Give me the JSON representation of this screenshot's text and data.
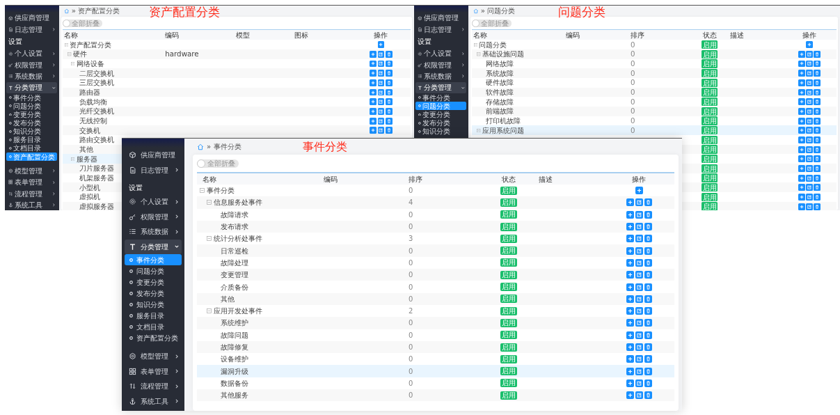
{
  "windows": [
    {
      "annotation": "资产配置分类",
      "breadcrumb": {
        "separator": "»",
        "current": "资产配置分类"
      },
      "toggle": {
        "label": "全部折叠",
        "on": false
      },
      "sidebar": [
        {
          "kind": "menu",
          "label": "供应商管理"
        },
        {
          "kind": "menu",
          "label": "日志管理",
          "expanded": false
        },
        {
          "kind": "section",
          "label": "设置"
        },
        {
          "kind": "menu",
          "label": "个人设置",
          "expanded": false
        },
        {
          "kind": "menu",
          "label": "权限管理",
          "expanded": false
        },
        {
          "kind": "menu",
          "label": "系统数据",
          "expanded": false
        },
        {
          "kind": "menu",
          "label": "分类管理",
          "expanded": true,
          "children": [
            {
              "label": "事件分类",
              "selected": false
            },
            {
              "label": "问题分类",
              "selected": false
            },
            {
              "label": "变更分类",
              "selected": false
            },
            {
              "label": "发布分类",
              "selected": false
            },
            {
              "label": "知识分类",
              "selected": false
            },
            {
              "label": "服务目录",
              "selected": false
            },
            {
              "label": "文档目录",
              "selected": false
            },
            {
              "label": "资产配置分类",
              "selected": true
            }
          ]
        },
        {
          "kind": "menu",
          "label": "模型管理",
          "expanded": false
        },
        {
          "kind": "menu",
          "label": "表单管理",
          "expanded": false
        },
        {
          "kind": "menu",
          "label": "流程管理",
          "expanded": false
        },
        {
          "kind": "menu",
          "label": "系统工具",
          "expanded": false
        }
      ],
      "table": {
        "columns": [
          {
            "label": "名称",
            "kind": "name"
          },
          {
            "label": "编码",
            "kind": "code"
          },
          {
            "label": "模型",
            "kind": "text"
          },
          {
            "label": "图标",
            "kind": "text"
          },
          {
            "label": "操作",
            "kind": "actions"
          }
        ],
        "rows": [
          {
            "name": "资产配置分类",
            "expanded": true,
            "highlighted": false,
            "actions": [
              {
                "kind": "add"
              }
            ],
            "children": [
              {
                "name": "硬件",
                "code": "hardware",
                "expanded": true,
                "highlighted": false,
                "actions": [
                  {
                    "kind": "add"
                  },
                  {
                    "kind": "edit"
                  },
                  {
                    "kind": "delete"
                  }
                ],
                "children": [
                  {
                    "name": "网络设备",
                    "expanded": true,
                    "highlighted": false,
                    "actions": [
                      {
                        "kind": "add"
                      },
                      {
                        "kind": "edit"
                      },
                      {
                        "kind": "delete"
                      }
                    ],
                    "children": [
                      {
                        "name": "二层交换机",
                        "highlighted": false,
                        "actions": [
                          {
                            "kind": "add"
                          },
                          {
                            "kind": "edit"
                          },
                          {
                            "kind": "delete"
                          }
                        ]
                      },
                      {
                        "name": "三层交换机",
                        "highlighted": false,
                        "actions": [
                          {
                            "kind": "add"
                          },
                          {
                            "kind": "edit"
                          },
                          {
                            "kind": "delete"
                          }
                        ]
                      },
                      {
                        "name": "路由器",
                        "highlighted": false,
                        "actions": [
                          {
                            "kind": "add"
                          },
                          {
                            "kind": "edit"
                          },
                          {
                            "kind": "delete"
                          }
                        ]
                      },
                      {
                        "name": "负载均衡",
                        "highlighted": false,
                        "actions": [
                          {
                            "kind": "add"
                          },
                          {
                            "kind": "edit"
                          },
                          {
                            "kind": "delete"
                          }
                        ]
                      },
                      {
                        "name": "光纤交换机",
                        "highlighted": false,
                        "actions": [
                          {
                            "kind": "add"
                          },
                          {
                            "kind": "edit"
                          },
                          {
                            "kind": "delete"
                          }
                        ]
                      },
                      {
                        "name": "无线控制",
                        "highlighted": false,
                        "actions": [
                          {
                            "kind": "add"
                          },
                          {
                            "kind": "edit"
                          },
                          {
                            "kind": "delete"
                          }
                        ]
                      },
                      {
                        "name": "交换机",
                        "highlighted": false,
                        "actions": [
                          {
                            "kind": "add"
                          },
                          {
                            "kind": "edit"
                          },
                          {
                            "kind": "delete"
                          }
                        ]
                      },
                      {
                        "name": "路由交换机",
                        "highlighted": false
                      },
                      {
                        "name": "其他",
                        "highlighted": false
                      }
                    ]
                  },
                  {
                    "name": "服务器",
                    "expanded": true,
                    "highlighted": true,
                    "children": [
                      {
                        "name": "刀片服务器",
                        "highlighted": false
                      },
                      {
                        "name": "机架服务器",
                        "highlighted": false
                      },
                      {
                        "name": "小型机",
                        "highlighted": false
                      },
                      {
                        "name": "虚拟机",
                        "highlighted": false
                      },
                      {
                        "name": "虚拟服务器",
                        "highlighted": false
                      }
                    ]
                  }
                ]
              }
            ]
          }
        ]
      }
    },
    {
      "annotation": "问题分类",
      "breadcrumb": {
        "separator": "»",
        "current": "问题分类"
      },
      "toggle": {
        "label": "全部折叠",
        "on": false
      },
      "sidebar": [
        {
          "kind": "menu",
          "label": "供应商管理"
        },
        {
          "kind": "menu",
          "label": "日志管理",
          "expanded": false
        },
        {
          "kind": "section",
          "label": "设置"
        },
        {
          "kind": "menu",
          "label": "个人设置",
          "expanded": false
        },
        {
          "kind": "menu",
          "label": "权限管理",
          "expanded": false
        },
        {
          "kind": "menu",
          "label": "系统数据",
          "expanded": false
        },
        {
          "kind": "menu",
          "label": "分类管理",
          "expanded": true,
          "children": [
            {
              "label": "事件分类",
              "selected": false
            },
            {
              "label": "问题分类",
              "selected": true
            },
            {
              "label": "变更分类",
              "selected": false
            },
            {
              "label": "发布分类",
              "selected": false
            },
            {
              "label": "知识分类",
              "selected": false
            }
          ]
        }
      ],
      "table": {
        "columns": [
          {
            "label": "名称",
            "kind": "name"
          },
          {
            "label": "编码",
            "kind": "code"
          },
          {
            "label": "排序",
            "kind": "sort"
          },
          {
            "label": "状态",
            "kind": "status"
          },
          {
            "label": "描述",
            "kind": "text"
          },
          {
            "label": "操作",
            "kind": "actions"
          }
        ],
        "rows": [
          {
            "name": "问题分类",
            "sort": "0",
            "status": "启用",
            "expanded": true,
            "highlighted": false,
            "actions": [
              {
                "kind": "add"
              }
            ],
            "children": [
              {
                "name": "基础设施问题",
                "sort": "0",
                "status": "启用",
                "expanded": true,
                "highlighted": false,
                "actions": [
                  {
                    "kind": "add"
                  },
                  {
                    "kind": "edit"
                  },
                  {
                    "kind": "delete"
                  }
                ],
                "children": [
                  {
                    "name": "网络故障",
                    "sort": "0",
                    "status": "启用",
                    "highlighted": false,
                    "actions": [
                      {
                        "kind": "add"
                      },
                      {
                        "kind": "edit"
                      },
                      {
                        "kind": "delete"
                      }
                    ]
                  },
                  {
                    "name": "系统故障",
                    "sort": "0",
                    "status": "启用",
                    "highlighted": false,
                    "actions": [
                      {
                        "kind": "add"
                      },
                      {
                        "kind": "edit"
                      },
                      {
                        "kind": "delete"
                      }
                    ]
                  },
                  {
                    "name": "硬件故障",
                    "sort": "0",
                    "status": "启用",
                    "highlighted": false,
                    "actions": [
                      {
                        "kind": "add"
                      },
                      {
                        "kind": "edit"
                      },
                      {
                        "kind": "delete"
                      }
                    ]
                  },
                  {
                    "name": "软件故障",
                    "sort": "0",
                    "status": "启用",
                    "highlighted": false,
                    "actions": [
                      {
                        "kind": "add"
                      },
                      {
                        "kind": "edit"
                      },
                      {
                        "kind": "delete"
                      }
                    ]
                  },
                  {
                    "name": "存储故障",
                    "sort": "0",
                    "status": "启用",
                    "highlighted": false,
                    "actions": [
                      {
                        "kind": "add"
                      },
                      {
                        "kind": "edit"
                      },
                      {
                        "kind": "delete"
                      }
                    ]
                  },
                  {
                    "name": "前端故障",
                    "sort": "0",
                    "status": "启用",
                    "highlighted": false,
                    "actions": [
                      {
                        "kind": "add"
                      },
                      {
                        "kind": "edit"
                      },
                      {
                        "kind": "delete"
                      }
                    ]
                  },
                  {
                    "name": "打印机故障",
                    "sort": "0",
                    "status": "启用",
                    "highlighted": false,
                    "actions": [
                      {
                        "kind": "add"
                      },
                      {
                        "kind": "edit"
                      },
                      {
                        "kind": "delete"
                      }
                    ]
                  }
                ]
              },
              {
                "name": "应用系统问题",
                "sort": "0",
                "status": "启用",
                "expanded": true,
                "highlighted": true,
                "actions": [
                  {
                    "kind": "add"
                  },
                  {
                    "kind": "edit"
                  },
                  {
                    "kind": "delete"
                  }
                ],
                "children": [
                  {
                    "status": "启用",
                    "highlighted": false,
                    "actions": [
                      {
                        "kind": "add"
                      },
                      {
                        "kind": "edit"
                      },
                      {
                        "kind": "delete"
                      }
                    ]
                  },
                  {
                    "status": "启用",
                    "highlighted": false,
                    "actions": [
                      {
                        "kind": "add"
                      },
                      {
                        "kind": "edit"
                      },
                      {
                        "kind": "delete"
                      }
                    ]
                  },
                  {
                    "status": "启用",
                    "highlighted": false,
                    "actions": [
                      {
                        "kind": "add"
                      },
                      {
                        "kind": "edit"
                      },
                      {
                        "kind": "delete"
                      }
                    ]
                  },
                  {
                    "status": "启用",
                    "highlighted": false,
                    "actions": [
                      {
                        "kind": "add"
                      },
                      {
                        "kind": "edit"
                      },
                      {
                        "kind": "delete"
                      }
                    ]
                  },
                  {
                    "status": "启用",
                    "highlighted": false,
                    "actions": [
                      {
                        "kind": "add"
                      },
                      {
                        "kind": "edit"
                      },
                      {
                        "kind": "delete"
                      }
                    ]
                  },
                  {
                    "status": "启用",
                    "highlighted": false,
                    "actions": [
                      {
                        "kind": "add"
                      },
                      {
                        "kind": "edit"
                      },
                      {
                        "kind": "delete"
                      }
                    ]
                  },
                  {
                    "status": "启用",
                    "highlighted": false,
                    "actions": [
                      {
                        "kind": "add"
                      },
                      {
                        "kind": "edit"
                      },
                      {
                        "kind": "delete"
                      }
                    ]
                  },
                  {
                    "status": "启用",
                    "highlighted": false,
                    "actions": [
                      {
                        "kind": "add"
                      },
                      {
                        "kind": "edit"
                      },
                      {
                        "kind": "delete"
                      }
                    ]
                  }
                ]
              }
            ]
          }
        ]
      }
    },
    {
      "annotation": "事件分类",
      "breadcrumb": {
        "separator": "»",
        "current": "事件分类"
      },
      "toggle": {
        "label": "全部折叠",
        "on": false
      },
      "sidebar": [
        {
          "kind": "menu",
          "label": "供应商管理"
        },
        {
          "kind": "menu",
          "label": "日志管理",
          "expanded": false
        },
        {
          "kind": "section",
          "label": "设置"
        },
        {
          "kind": "menu",
          "label": "个人设置",
          "expanded": false
        },
        {
          "kind": "menu",
          "label": "权限管理",
          "expanded": false
        },
        {
          "kind": "menu",
          "label": "系统数据",
          "expanded": false
        },
        {
          "kind": "menu",
          "label": "分类管理",
          "expanded": true,
          "children": [
            {
              "label": "事件分类",
              "selected": true
            },
            {
              "label": "问题分类",
              "selected": false
            },
            {
              "label": "变更分类",
              "selected": false
            },
            {
              "label": "发布分类",
              "selected": false
            },
            {
              "label": "知识分类",
              "selected": false
            },
            {
              "label": "服务目录",
              "selected": false
            },
            {
              "label": "文档目录",
              "selected": false
            },
            {
              "label": "资产配置分类",
              "selected": false
            }
          ]
        },
        {
          "kind": "menu",
          "label": "模型管理",
          "expanded": false
        },
        {
          "kind": "menu",
          "label": "表单管理",
          "expanded": false
        },
        {
          "kind": "menu",
          "label": "流程管理",
          "expanded": false
        },
        {
          "kind": "menu",
          "label": "系统工具",
          "expanded": false
        }
      ],
      "table": {
        "columns": [
          {
            "label": "名称",
            "kind": "name"
          },
          {
            "label": "编码",
            "kind": "code"
          },
          {
            "label": "排序",
            "kind": "sort"
          },
          {
            "label": "状态",
            "kind": "status"
          },
          {
            "label": "描述",
            "kind": "text"
          },
          {
            "label": "操作",
            "kind": "actions"
          }
        ],
        "rows": [
          {
            "name": "事件分类",
            "sort": "0",
            "status": "启用",
            "expanded": true,
            "highlighted": false,
            "actions": [
              {
                "kind": "add"
              }
            ],
            "children": [
              {
                "name": "信息服务处事件",
                "sort": "4",
                "status": "启用",
                "expanded": true,
                "highlighted": false,
                "actions": [
                  {
                    "kind": "add"
                  },
                  {
                    "kind": "edit"
                  },
                  {
                    "kind": "delete"
                  }
                ],
                "children": [
                  {
                    "name": "故障请求",
                    "sort": "0",
                    "status": "启用",
                    "highlighted": false,
                    "actions": [
                      {
                        "kind": "add"
                      },
                      {
                        "kind": "edit"
                      },
                      {
                        "kind": "delete"
                      }
                    ]
                  },
                  {
                    "name": "发布请求",
                    "sort": "0",
                    "status": "启用",
                    "highlighted": false,
                    "actions": [
                      {
                        "kind": "add"
                      },
                      {
                        "kind": "edit"
                      },
                      {
                        "kind": "delete"
                      }
                    ]
                  }
                ]
              },
              {
                "name": "统计分析处事件",
                "sort": "3",
                "status": "启用",
                "expanded": true,
                "highlighted": false,
                "actions": [
                  {
                    "kind": "add"
                  },
                  {
                    "kind": "edit"
                  },
                  {
                    "kind": "delete"
                  }
                ],
                "children": [
                  {
                    "name": "日常巡检",
                    "sort": "0",
                    "status": "启用",
                    "highlighted": false,
                    "actions": [
                      {
                        "kind": "add"
                      },
                      {
                        "kind": "edit"
                      },
                      {
                        "kind": "delete"
                      }
                    ]
                  },
                  {
                    "name": "故障处理",
                    "sort": "0",
                    "status": "启用",
                    "highlighted": false,
                    "actions": [
                      {
                        "kind": "add"
                      },
                      {
                        "kind": "edit"
                      },
                      {
                        "kind": "delete"
                      }
                    ]
                  },
                  {
                    "name": "变更管理",
                    "sort": "0",
                    "status": "启用",
                    "highlighted": false,
                    "actions": [
                      {
                        "kind": "add"
                      },
                      {
                        "kind": "edit"
                      },
                      {
                        "kind": "delete"
                      }
                    ]
                  },
                  {
                    "name": "介质备份",
                    "sort": "0",
                    "status": "启用",
                    "highlighted": false,
                    "actions": [
                      {
                        "kind": "add"
                      },
                      {
                        "kind": "edit"
                      },
                      {
                        "kind": "delete"
                      }
                    ]
                  },
                  {
                    "name": "其他",
                    "sort": "0",
                    "status": "启用",
                    "highlighted": false,
                    "actions": [
                      {
                        "kind": "add"
                      },
                      {
                        "kind": "edit"
                      },
                      {
                        "kind": "delete"
                      }
                    ]
                  }
                ]
              },
              {
                "name": "应用开发处事件",
                "sort": "2",
                "status": "启用",
                "expanded": true,
                "highlighted": false,
                "actions": [
                  {
                    "kind": "add"
                  },
                  {
                    "kind": "edit"
                  },
                  {
                    "kind": "delete"
                  }
                ],
                "children": [
                  {
                    "name": "系统维护",
                    "sort": "0",
                    "status": "启用",
                    "highlighted": false,
                    "actions": [
                      {
                        "kind": "add"
                      },
                      {
                        "kind": "edit"
                      },
                      {
                        "kind": "delete"
                      }
                    ]
                  },
                  {
                    "name": "故障问题",
                    "sort": "0",
                    "status": "启用",
                    "highlighted": false,
                    "actions": [
                      {
                        "kind": "add"
                      },
                      {
                        "kind": "edit"
                      },
                      {
                        "kind": "delete"
                      }
                    ]
                  },
                  {
                    "name": "故障修复",
                    "sort": "0",
                    "status": "启用",
                    "highlighted": false,
                    "actions": [
                      {
                        "kind": "add"
                      },
                      {
                        "kind": "edit"
                      },
                      {
                        "kind": "delete"
                      }
                    ]
                  },
                  {
                    "name": "设备维护",
                    "sort": "0",
                    "status": "启用",
                    "highlighted": false,
                    "actions": [
                      {
                        "kind": "add"
                      },
                      {
                        "kind": "edit"
                      },
                      {
                        "kind": "delete"
                      }
                    ]
                  },
                  {
                    "name": "漏洞升级",
                    "sort": "0",
                    "status": "启用",
                    "highlighted": true,
                    "actions": [
                      {
                        "kind": "add"
                      },
                      {
                        "kind": "edit"
                      },
                      {
                        "kind": "delete"
                      }
                    ]
                  },
                  {
                    "name": "数据备份",
                    "sort": "0",
                    "status": "启用",
                    "highlighted": false,
                    "actions": [
                      {
                        "kind": "add"
                      },
                      {
                        "kind": "edit"
                      },
                      {
                        "kind": "delete"
                      }
                    ]
                  },
                  {
                    "name": "其他服务",
                    "sort": "0",
                    "status": "启用",
                    "highlighted": false,
                    "actions": [
                      {
                        "kind": "add"
                      },
                      {
                        "kind": "edit"
                      },
                      {
                        "kind": "delete"
                      }
                    ]
                  }
                ]
              }
            ]
          }
        ]
      }
    }
  ]
}
